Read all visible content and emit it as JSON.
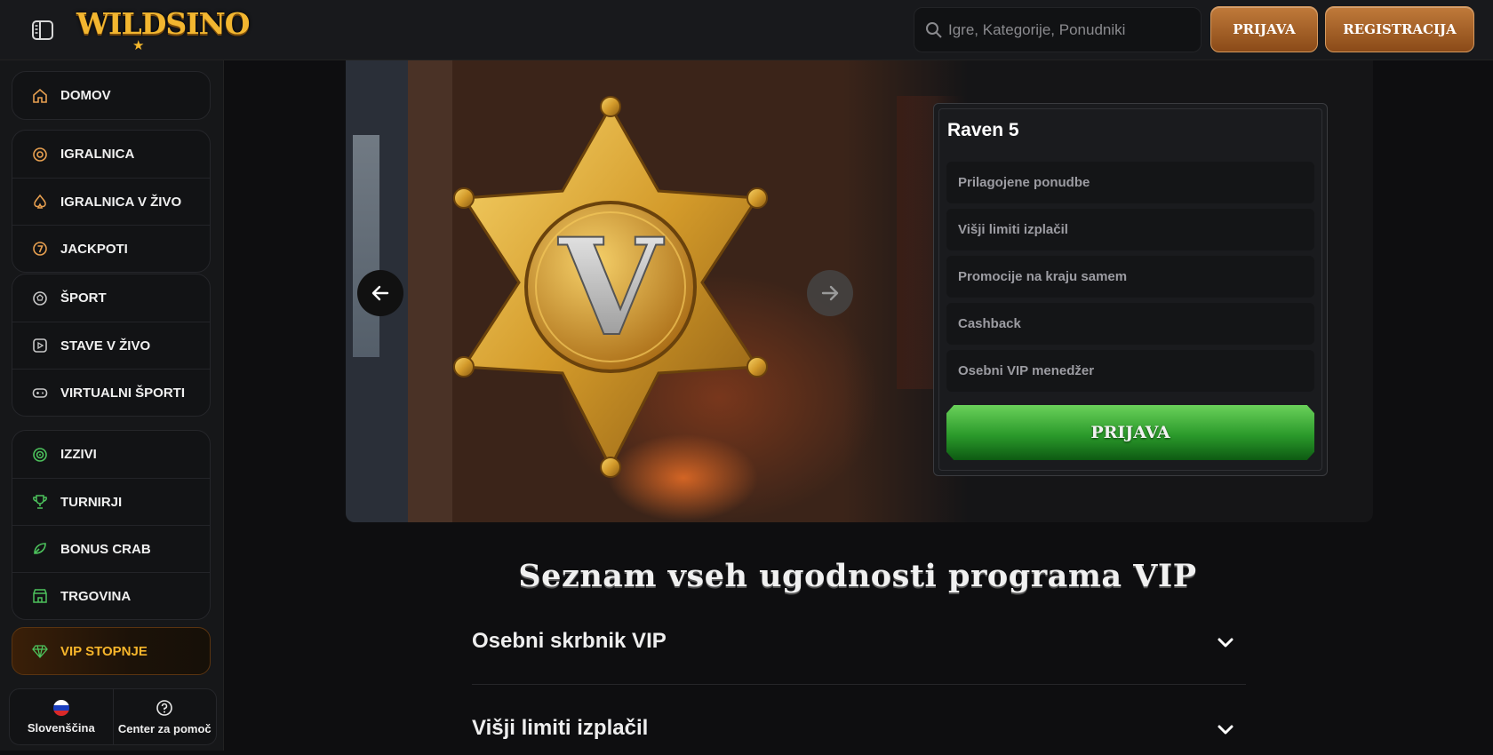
{
  "header": {
    "logo_text": "WILDSINO",
    "search_placeholder": "Igre, Kategorije, Ponudniki",
    "login_label": "PRIJAVA",
    "register_label": "REGISTRACIJA"
  },
  "sidebar": {
    "group1": [
      {
        "label": "DOMOV",
        "icon": "home-icon"
      }
    ],
    "group2": [
      {
        "label": "IGRALNICA",
        "icon": "chip-icon"
      },
      {
        "label": "IGRALNICA V ŽIVO",
        "icon": "spade-icon"
      },
      {
        "label": "JACKPOTI",
        "icon": "seven-icon"
      }
    ],
    "group3": [
      {
        "label": "ŠPORT",
        "icon": "ball-icon"
      },
      {
        "label": "STAVE V ŽIVO",
        "icon": "play-icon"
      },
      {
        "label": "VIRTUALNI ŠPORTI",
        "icon": "gamepad-icon"
      }
    ],
    "group4": [
      {
        "label": "IZZIVI",
        "icon": "target-icon"
      },
      {
        "label": "TURNIRJI",
        "icon": "trophy-icon"
      },
      {
        "label": "BONUS CRAB",
        "icon": "crab-icon"
      },
      {
        "label": "TRGOVINA",
        "icon": "shop-icon"
      }
    ],
    "vip_label": "VIP STOPNJE",
    "language_label": "Slovenščina",
    "help_label": "Center za pomoč"
  },
  "hero": {
    "badge_letter": "V"
  },
  "panel": {
    "title": "Raven 5",
    "benefits": [
      "Prilagojene ponudbe",
      "Višji limiti izplačil",
      "Promocije na kraju samem",
      "Cashback",
      "Osebni VIP menedžer"
    ],
    "cta_label": "PRIJAVA"
  },
  "section": {
    "title": "Seznam vseh ugodnosti programa VIP",
    "accordion": [
      "Osebni skrbnik VIP",
      "Višji limiti izplačil"
    ]
  },
  "colors": {
    "accent_gold": "#f2b630",
    "button_bronze": "#a8642a",
    "cta_green": "#2b9a2b",
    "vip_text": "#f6b52b"
  }
}
